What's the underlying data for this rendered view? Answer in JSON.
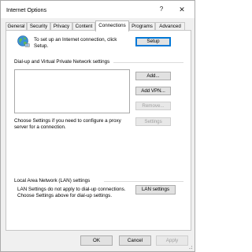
{
  "window": {
    "title": "Internet Options",
    "help_glyph": "?",
    "close_glyph": "✕"
  },
  "tabs": [
    {
      "label": "General"
    },
    {
      "label": "Security"
    },
    {
      "label": "Privacy"
    },
    {
      "label": "Content"
    },
    {
      "label": "Connections"
    },
    {
      "label": "Programs"
    },
    {
      "label": "Advanced"
    }
  ],
  "active_tab": "Connections",
  "setup": {
    "text": "To set up an Internet connection, click Setup.",
    "button": "Setup",
    "icon": "globe-network-icon"
  },
  "dialup": {
    "heading": "Dial-up and Virtual Private Network settings",
    "add_button": "Add...",
    "add_vpn_button": "Add VPN...",
    "remove_button": "Remove...",
    "settings_button": "Settings",
    "proxy_text": "Choose Settings if you need to configure a proxy server for a connection."
  },
  "lan": {
    "heading": "Local Area Network (LAN) settings",
    "text": "LAN Settings do not apply to dial-up connections. Choose Settings above for dial-up settings.",
    "button": "LAN settings"
  },
  "footer": {
    "ok": "OK",
    "cancel": "Cancel",
    "apply": "Apply"
  },
  "colors": {
    "focus_accent": "#0078d7",
    "disabled_text": "#a0a0a0"
  }
}
